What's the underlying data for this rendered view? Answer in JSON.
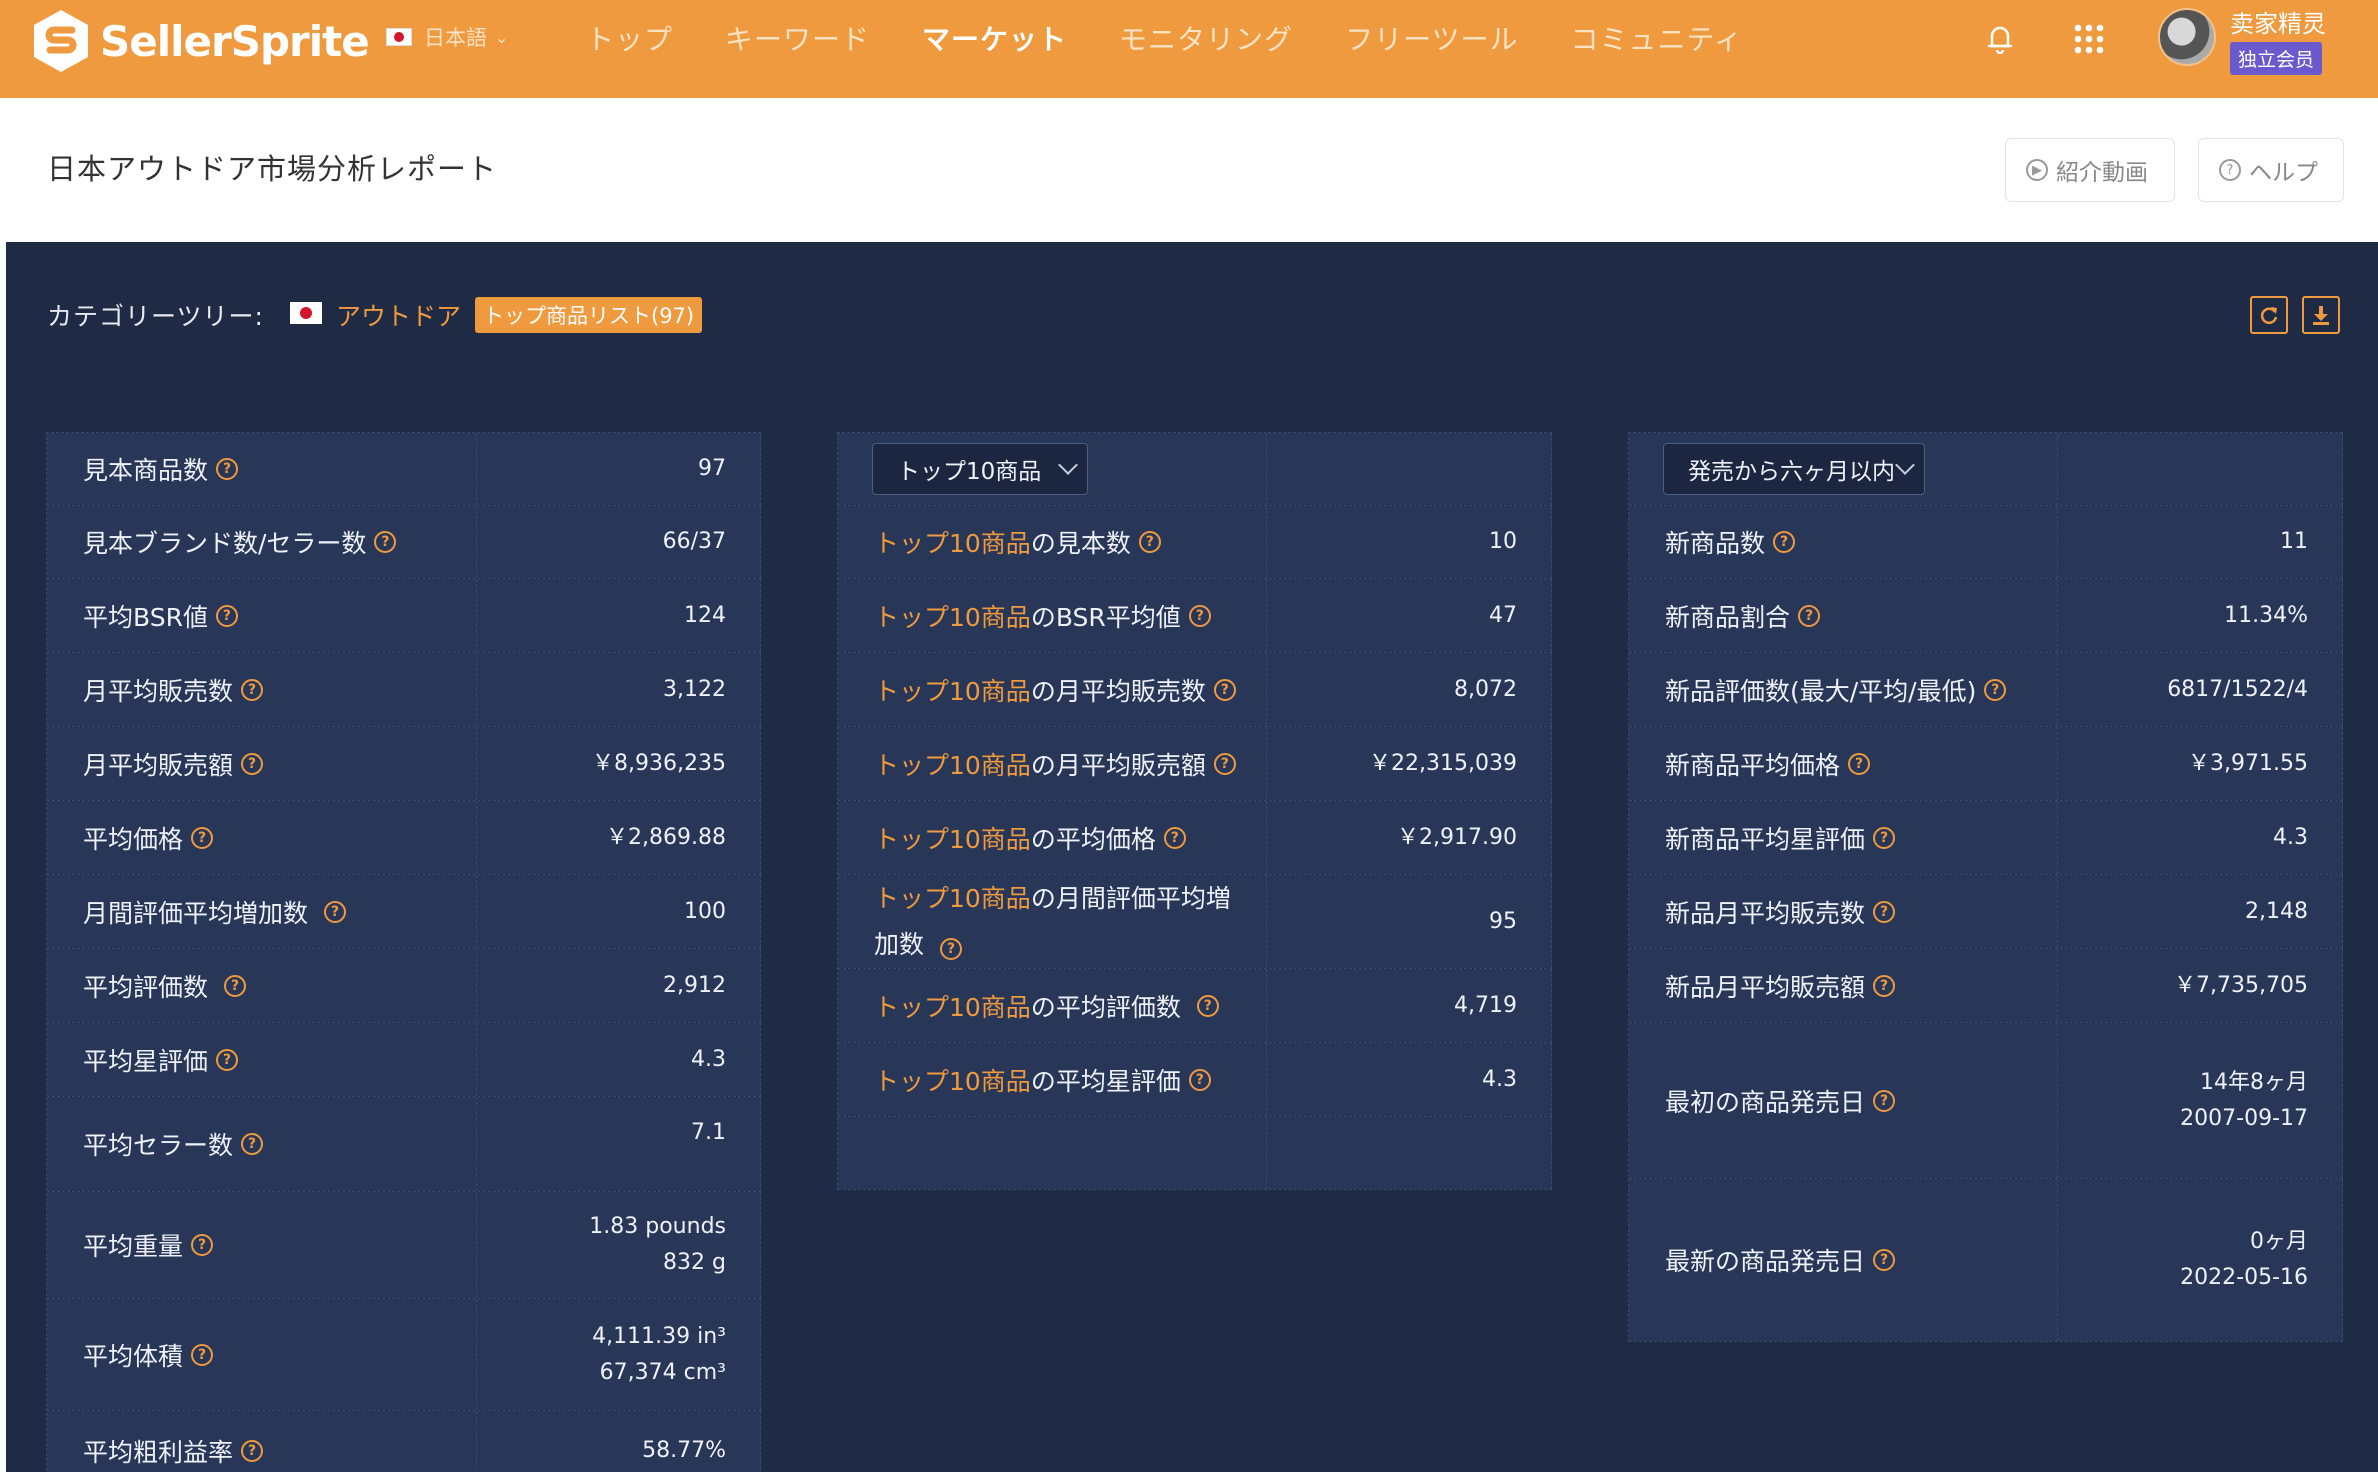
{
  "brand": {
    "name": "SellerSprite"
  },
  "lang": {
    "label": "日本語"
  },
  "nav": {
    "items": [
      {
        "label": "トップ"
      },
      {
        "label": "キーワード"
      },
      {
        "label": "マーケット"
      },
      {
        "label": "モニタリング"
      },
      {
        "label": "フリーツール"
      },
      {
        "label": "コミュニティ"
      }
    ],
    "active": "マーケット"
  },
  "user": {
    "name": "卖家精灵",
    "badge": "独立会员"
  },
  "header": {
    "title": "日本アウトドア市場分析レポート",
    "video_label": "紹介動画",
    "help_label": "ヘルプ"
  },
  "category": {
    "label": "カテゴリーツリー:",
    "link": "アウトドア",
    "badge": "トップ商品リスト(97)"
  },
  "overview": {
    "rows": [
      {
        "label": "見本商品数",
        "value": "97"
      },
      {
        "label": "見本ブランド数/セラー数",
        "value": "66/37"
      },
      {
        "label": "平均BSR値",
        "value": "124"
      },
      {
        "label": "月平均販売数",
        "value": "3,122"
      },
      {
        "label": "月平均販売額",
        "value": "￥8,936,235"
      },
      {
        "label": "平均価格",
        "value": "￥2,869.88"
      },
      {
        "label": "月間評価平均増加数",
        "value": "100"
      },
      {
        "label": "平均評価数",
        "value": "2,912"
      },
      {
        "label": "平均星評価",
        "value": "4.3"
      },
      {
        "label": "平均セラー数",
        "value": "7.1"
      },
      {
        "label": "平均重量",
        "value": "1.83 pounds",
        "value2": "832 g"
      },
      {
        "label": "平均体積",
        "value": "4,111.39 in³",
        "value2": "67,374 cm³"
      },
      {
        "label": "平均粗利益率",
        "value": "58.77%"
      }
    ]
  },
  "top10": {
    "select_label": "トップ10商品",
    "prefix": "トップ10商品",
    "rows": [
      {
        "suffix": "の見本数",
        "value": "10"
      },
      {
        "suffix": "のBSR平均値",
        "value": "47"
      },
      {
        "suffix": "の月平均販売数",
        "value": "8,072"
      },
      {
        "suffix": "の月平均販売額",
        "value": "￥22,315,039"
      },
      {
        "suffix": "の平均価格",
        "value": "￥2,917.90"
      },
      {
        "suffix": "の月間評価平均増",
        "suffix2": "加数",
        "value": "95"
      },
      {
        "suffix": "の平均評価数",
        "value": "4,719"
      },
      {
        "suffix": "の平均星評価",
        "value": "4.3"
      }
    ]
  },
  "new_products": {
    "select_label": "発売から六ヶ月以内",
    "rows": [
      {
        "label": "新商品数",
        "value": "11"
      },
      {
        "label": "新商品割合",
        "value": "11.34%"
      },
      {
        "label": "新品評価数(最大/平均/最低)",
        "value": "6817/1522/4"
      },
      {
        "label": "新商品平均価格",
        "value": "￥3,971.55"
      },
      {
        "label": "新商品平均星評価",
        "value": "4.3"
      },
      {
        "label": "新品月平均販売数",
        "value": "2,148"
      },
      {
        "label": "新品月平均販売額",
        "value": "￥7,735,705"
      },
      {
        "label": "最初の商品発売日",
        "value": "14年8ヶ月",
        "value2": "2007-09-17"
      },
      {
        "label": "最新の商品発売日",
        "value": "0ヶ月",
        "value2": "2022-05-16"
      }
    ]
  },
  "colors": {
    "accent": "#ef9a3e",
    "panel": "#1f2a44",
    "row": "#283657"
  },
  "help_glyph": "?"
}
